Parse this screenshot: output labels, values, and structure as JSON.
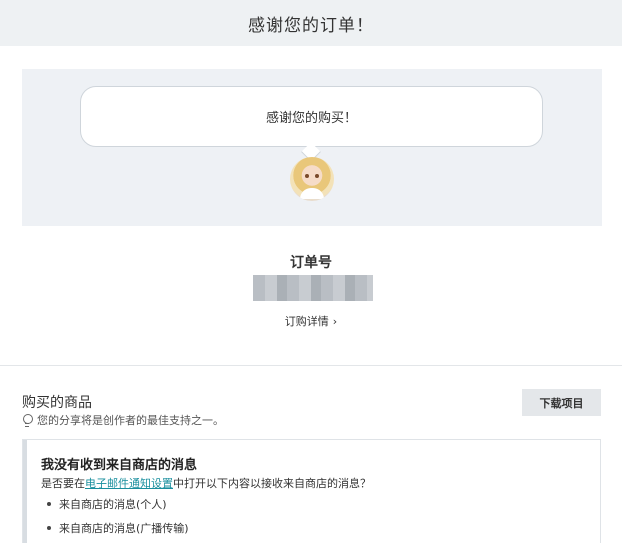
{
  "header": {
    "title": "感谢您的订单！"
  },
  "hero": {
    "bubble_text": "感谢您的购买！"
  },
  "order": {
    "label": "订单号",
    "number": "",
    "detail_link": "订购详情",
    "detail_chevron": "›"
  },
  "purchased": {
    "title": "购买的商品",
    "subtitle": "您的分享将是创作者的最佳支持之一。",
    "download_button": "下载项目"
  },
  "notice": {
    "title": "我没有收到来自商店的消息",
    "text_before": "是否要在",
    "link_text": "电子邮件通知设置",
    "text_after": "中打开以下内容以接收来自商店的消息？",
    "items": [
      "来自商店的消息(个人)",
      "来自商店的消息(广播传输)"
    ]
  },
  "colors": {
    "header_bg": "#eef1f3",
    "hero_bg": "#eef1f5",
    "link": "#1a8f9e",
    "button_bg": "#e4e7ea"
  }
}
